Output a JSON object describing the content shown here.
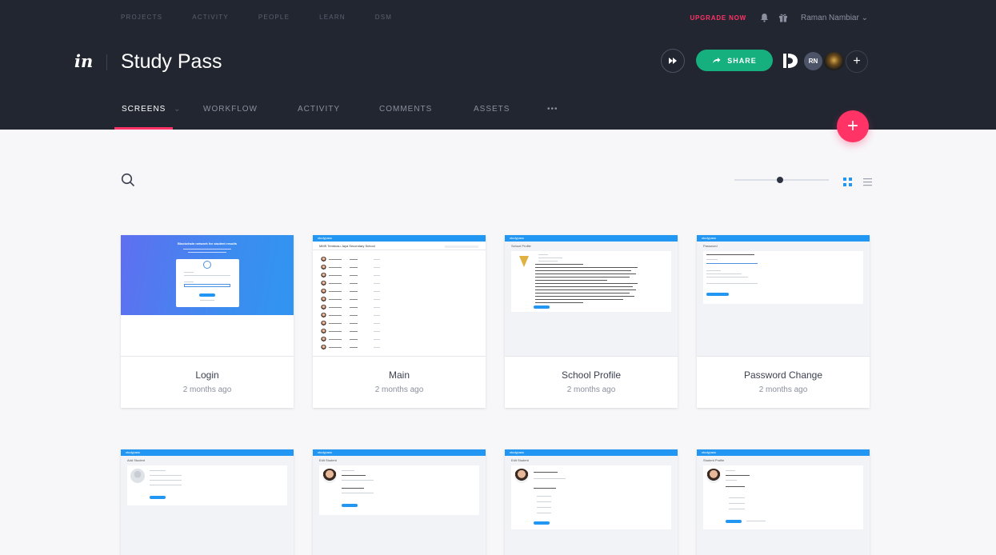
{
  "topnav": {
    "items": [
      "PROJECTS",
      "ACTIVITY",
      "PEOPLE",
      "LEARN",
      "DSM"
    ],
    "upgrade_label": "UPGRADE NOW",
    "user_name": "Raman Nambiar"
  },
  "header": {
    "logo_text": "in",
    "project_title": "Study Pass",
    "share_label": "SHARE",
    "avatar_initials": "RN",
    "add_label": "+"
  },
  "tabs": [
    {
      "label": "SCREENS",
      "active": true
    },
    {
      "label": "WORKFLOW"
    },
    {
      "label": "ACTIVITY"
    },
    {
      "label": "COMMENTS"
    },
    {
      "label": "ASSETS"
    },
    {
      "label": "•••"
    }
  ],
  "fab_label": "+",
  "toolbar": {
    "view_mode": "grid",
    "zoom_fraction": 0.45
  },
  "screens": [
    {
      "name": "Login",
      "updated": "2 months ago"
    },
    {
      "name": "Main",
      "updated": "2 months ago"
    },
    {
      "name": "School Profile",
      "updated": "2 months ago"
    },
    {
      "name": "Password Change",
      "updated": "2 months ago"
    },
    {
      "name": "Add Student",
      "updated": ""
    },
    {
      "name": "Edit Student",
      "updated": ""
    },
    {
      "name": "Edit Student",
      "updated": ""
    },
    {
      "name": "Student Profile",
      "updated": ""
    }
  ],
  "thumbs": {
    "login_heading": "Blockchain network for student results",
    "mini_brand": "studypass",
    "main_org": "MMS Tembusu Jaya Secondary School",
    "school_profile_title": "School Profile",
    "password_title": "Password",
    "add_student_title": "Add Student",
    "edit_student_title": "Edit Student",
    "student_profile_title": "Student Profile"
  },
  "colors": {
    "header_bg": "#222631",
    "accent_pink": "#ff3366",
    "share_green": "#16b07e",
    "mini_blue": "#2196f3"
  }
}
